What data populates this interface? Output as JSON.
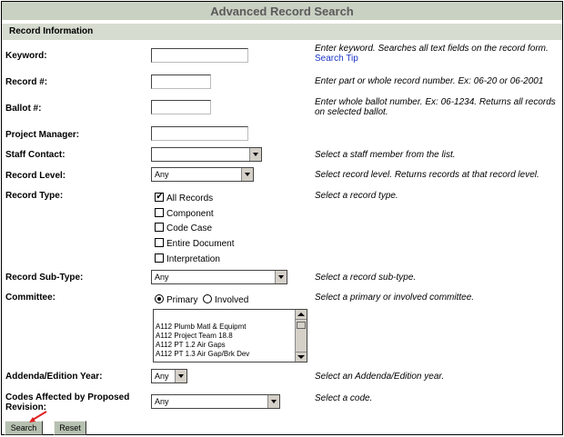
{
  "page": {
    "title": "Advanced Record Search",
    "section": "Record Information"
  },
  "fields": {
    "keyword": {
      "label": "Keyword:",
      "value": "",
      "help": "Enter keyword. Searches all text fields on the record form.",
      "tip": "Search Tip"
    },
    "record_no": {
      "label": "Record #:",
      "value": "",
      "help": "Enter part or whole record number. Ex: 06-20 or 06-2001"
    },
    "ballot_no": {
      "label": "Ballot #:",
      "value": "",
      "help": "Enter whole ballot number. Ex: 06-1234. Returns all records on selected ballot."
    },
    "project_manager": {
      "label": "Project Manager:",
      "value": ""
    },
    "staff_contact": {
      "label": "Staff Contact:",
      "value": "",
      "help": "Select a staff member from the list."
    },
    "record_level": {
      "label": "Record Level:",
      "value": "Any",
      "help": "Select record level. Returns records at that record level."
    },
    "record_type": {
      "label": "Record Type:",
      "help": "Select a record type.",
      "options": [
        {
          "label": "All Records",
          "checked": true
        },
        {
          "label": "Component",
          "checked": false
        },
        {
          "label": "Code Case",
          "checked": false
        },
        {
          "label": "Entire Document",
          "checked": false
        },
        {
          "label": "Interpretation",
          "checked": false
        }
      ]
    },
    "record_subtype": {
      "label": "Record Sub-Type:",
      "value": "Any",
      "help": "Select a record sub-type."
    },
    "committee": {
      "label": "Committee:",
      "help": "Select a primary or involved committee.",
      "radio_primary": "Primary",
      "radio_involved": "Involved",
      "selected": "Primary",
      "list": [
        "A112 Plumb Matl & Equipmt",
        "A112 Project Team 18.8",
        "A112 PT 1.2 Air Gaps",
        "A112 PT 1.3 Air Gap/Brk Dev"
      ]
    },
    "addenda_year": {
      "label": "Addenda/Edition Year:",
      "value": "Any",
      "help": "Select an Addenda/Edition year."
    },
    "codes_affected": {
      "label": "Codes Affected by Proposed Revision:",
      "value": "Any",
      "help": "Select a code."
    }
  },
  "buttons": {
    "search": "Search",
    "reset": "Reset"
  },
  "colors": {
    "title_bar": "#c9d1c3",
    "section_bar": "#d6ddd0",
    "button": "#b6c0b0",
    "annotation_arrow": "#e02020"
  }
}
